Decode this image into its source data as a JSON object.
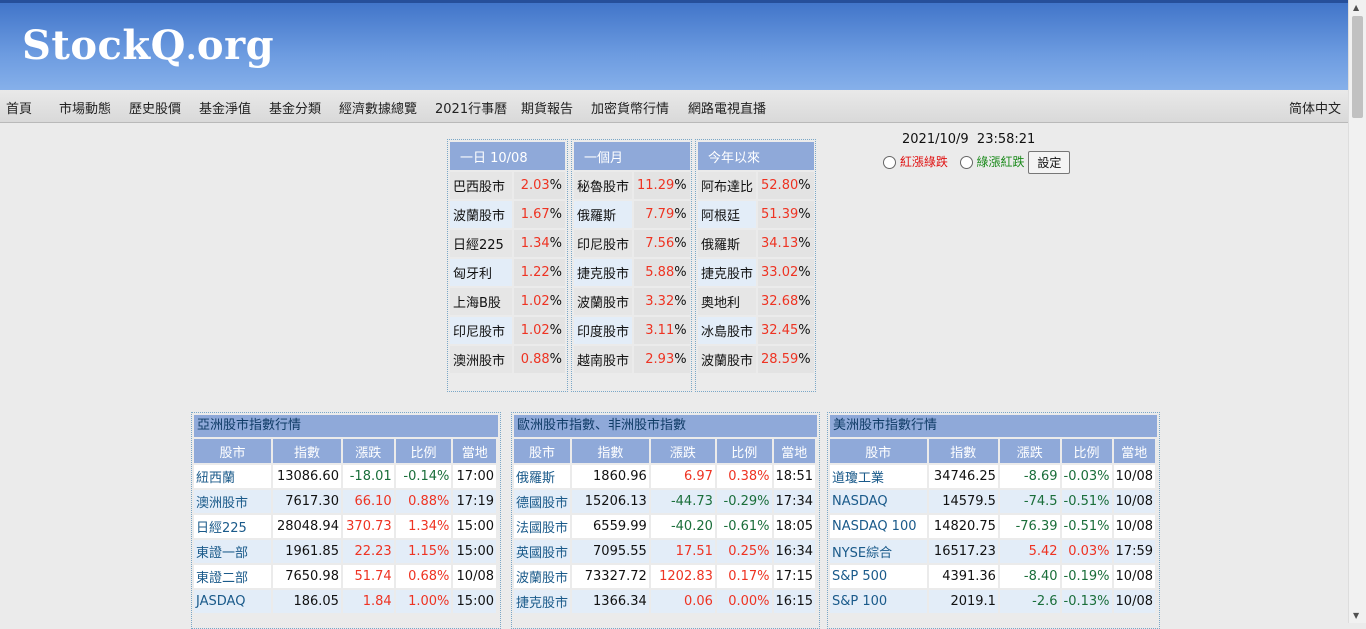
{
  "site": {
    "logo_main": "StockQ",
    "logo_dot": ".",
    "logo_suffix": "org"
  },
  "nav": {
    "left": [
      "首頁",
      "市場動態",
      "歷史股價",
      "基金淨值",
      "基金分類",
      "經濟數據總覽",
      "2021行事曆",
      "期貨報告",
      "加密貨幣行情",
      "網路電視直播"
    ],
    "right": "简体中文"
  },
  "datetime": "2021/10/9  23:58:21",
  "settings": {
    "option1": "紅漲綠跌",
    "option2": "綠漲紅跌",
    "button": "設定"
  },
  "colors": {
    "header_top": "#3f73c8",
    "header_bottom": "#86b0ea",
    "table_header": "#8fa9d9",
    "up": "#ee3322",
    "down": "#1a6e3a"
  },
  "performance": [
    {
      "header": "一日 10/08",
      "rows": [
        [
          "巴西股市",
          "2.03"
        ],
        [
          "波蘭股市",
          "1.67"
        ],
        [
          "日經225",
          "1.34"
        ],
        [
          "匈牙利",
          "1.22"
        ],
        [
          "上海B股",
          "1.02"
        ],
        [
          "印尼股市",
          "1.02"
        ],
        [
          "澳洲股市",
          "0.88"
        ]
      ]
    },
    {
      "header": "一個月",
      "rows": [
        [
          "秘魯股市",
          "11.29"
        ],
        [
          "俄羅斯",
          "7.79"
        ],
        [
          "印尼股市",
          "7.56"
        ],
        [
          "捷克股市",
          "5.88"
        ],
        [
          "波蘭股市",
          "3.32"
        ],
        [
          "印度股市",
          "3.11"
        ],
        [
          "越南股市",
          "2.93"
        ]
      ]
    },
    {
      "header": "今年以來",
      "rows": [
        [
          "阿布達比",
          "52.80"
        ],
        [
          "阿根廷",
          "51.39"
        ],
        [
          "俄羅斯",
          "34.13"
        ],
        [
          "捷克股市",
          "33.02"
        ],
        [
          "奧地利",
          "32.68"
        ],
        [
          "冰島股市",
          "32.45"
        ],
        [
          "波蘭股市",
          "28.59"
        ]
      ]
    }
  ],
  "pct_sign": "%",
  "markets": [
    {
      "title": "亞洲股市指數行情",
      "columns": [
        "股市",
        "指數",
        "漲跌",
        "比例",
        "當地"
      ],
      "rows": [
        [
          "紐西蘭",
          "13086.60",
          "-18.01",
          "-0.14%",
          "17:00"
        ],
        [
          "澳洲股市",
          "7617.30",
          "66.10",
          "0.88%",
          "17:19"
        ],
        [
          "日經225",
          "28048.94",
          "370.73",
          "1.34%",
          "15:00"
        ],
        [
          "東證一部",
          "1961.85",
          "22.23",
          "1.15%",
          "15:00"
        ],
        [
          "東證二部",
          "7650.98",
          "51.74",
          "0.68%",
          "10/08"
        ],
        [
          "JASDAQ",
          "186.05",
          "1.84",
          "1.00%",
          "15:00"
        ]
      ]
    },
    {
      "title": "歐洲股市指數、非洲股市指數",
      "columns": [
        "股市",
        "指數",
        "漲跌",
        "比例",
        "當地"
      ],
      "rows": [
        [
          "俄羅斯",
          "1860.96",
          "6.97",
          "0.38%",
          "18:51"
        ],
        [
          "德國股市",
          "15206.13",
          "-44.73",
          "-0.29%",
          "17:34"
        ],
        [
          "法國股市",
          "6559.99",
          "-40.20",
          "-0.61%",
          "18:05"
        ],
        [
          "英國股市",
          "7095.55",
          "17.51",
          "0.25%",
          "16:34"
        ],
        [
          "波蘭股市",
          "73327.72",
          "1202.83",
          "0.17%",
          "17:15"
        ],
        [
          "捷克股市",
          "1366.34",
          "0.06",
          "0.00%",
          "16:15"
        ]
      ]
    },
    {
      "title": "美洲股市指數行情",
      "columns": [
        "股市",
        "指數",
        "漲跌",
        "比例",
        "當地"
      ],
      "rows": [
        [
          "道瓊工業",
          "34746.25",
          "-8.69",
          "-0.03%",
          "10/08"
        ],
        [
          "NASDAQ",
          "14579.5",
          "-74.5",
          "-0.51%",
          "10/08"
        ],
        [
          "NASDAQ 100",
          "14820.75",
          "-76.39",
          "-0.51%",
          "10/08"
        ],
        [
          "NYSE綜合",
          "16517.23",
          "5.42",
          "0.03%",
          "17:59"
        ],
        [
          "S&P 500",
          "4391.36",
          "-8.40",
          "-0.19%",
          "10/08"
        ],
        [
          "S&P 100",
          "2019.1",
          "-2.6",
          "-0.13%",
          "10/08"
        ]
      ]
    }
  ]
}
